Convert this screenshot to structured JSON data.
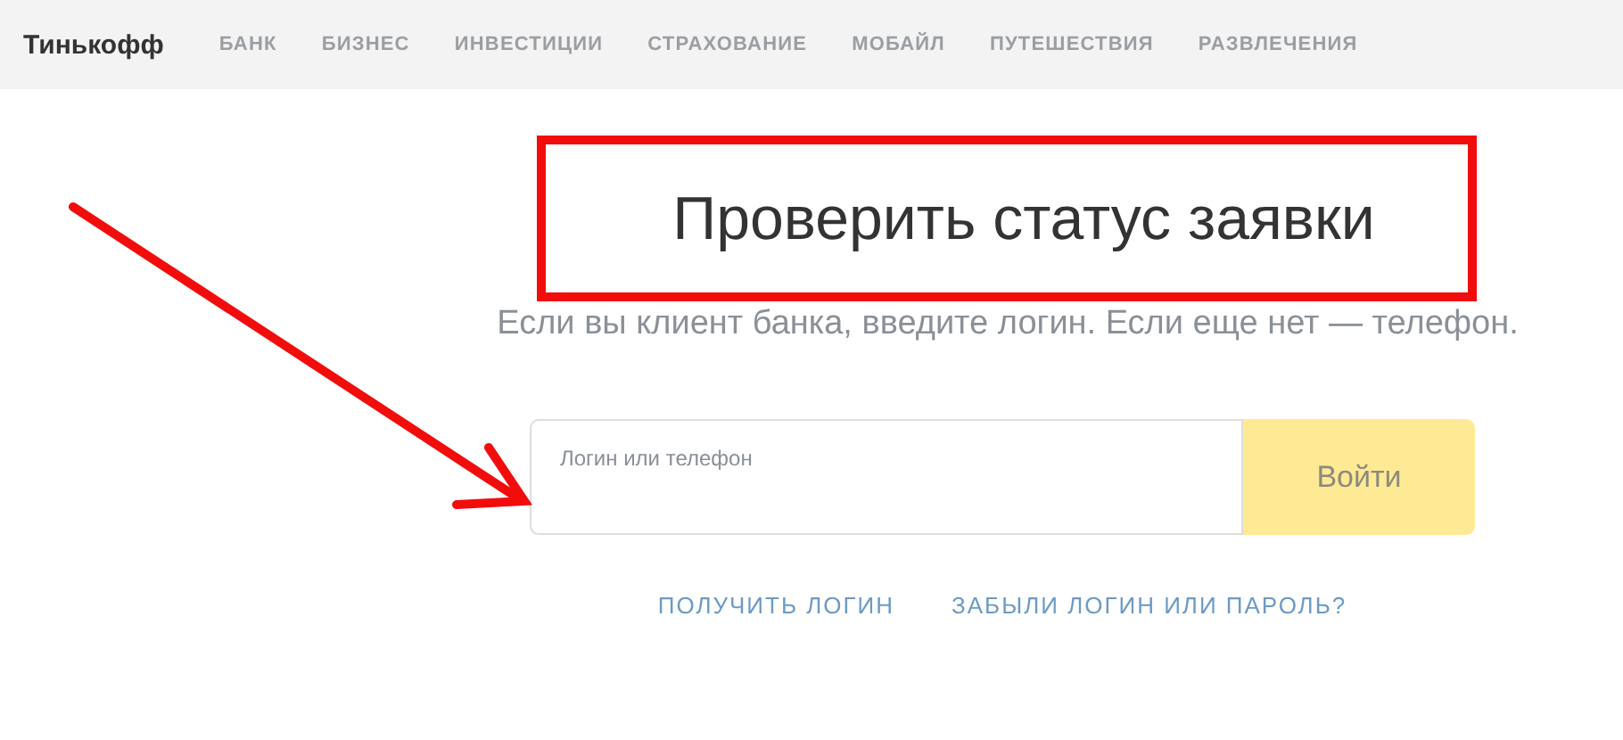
{
  "header": {
    "logo": "Тинькофф",
    "nav": [
      {
        "label": "БАНК"
      },
      {
        "label": "БИЗНЕС"
      },
      {
        "label": "ИНВЕСТИЦИИ"
      },
      {
        "label": "СТРАХОВАНИЕ"
      },
      {
        "label": "МОБАЙЛ"
      },
      {
        "label": "ПУТЕШЕСТВИЯ"
      },
      {
        "label": "РАЗВЛЕЧЕНИЯ"
      }
    ]
  },
  "title": "Проверить статус заявки",
  "subtitle": "Если вы клиент банка, введите логин. Если еще нет — телефон.",
  "login": {
    "placeholder": "Логин или телефон",
    "button": "Войти"
  },
  "links": [
    {
      "label": "ПОЛУЧИТЬ ЛОГИН"
    },
    {
      "label": "ЗАБЫЛИ ЛОГИН ИЛИ ПАРОЛЬ?"
    }
  ],
  "annotations": {
    "highlight_frame": true,
    "arrow": true
  }
}
